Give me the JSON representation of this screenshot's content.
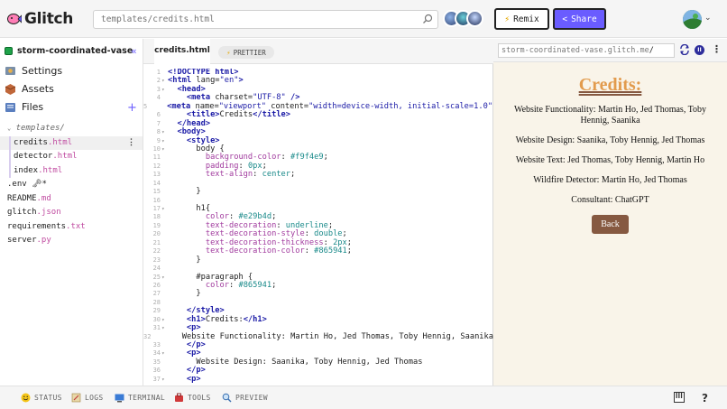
{
  "topbar": {
    "logo_text": "Glitch",
    "search_placeholder": "templates/credits.html",
    "remix_label": "Remix",
    "share_label": "Share"
  },
  "sidebar": {
    "project_name": "storm-coordinated-vase",
    "nav": [
      {
        "label": "Settings"
      },
      {
        "label": "Assets"
      },
      {
        "label": "Files"
      }
    ],
    "tree": [
      {
        "name": "templates/",
        "ext": "",
        "type": "folder"
      },
      {
        "name": "credits",
        "ext": ".html",
        "type": "child",
        "active": true
      },
      {
        "name": "detector",
        "ext": ".html",
        "type": "child"
      },
      {
        "name": "index",
        "ext": ".html",
        "type": "child"
      },
      {
        "name": ".env 🗝*",
        "ext": "",
        "type": "file"
      },
      {
        "name": "README",
        "ext": ".md",
        "type": "file"
      },
      {
        "name": "glitch",
        "ext": ".json",
        "type": "file"
      },
      {
        "name": "requirements",
        "ext": ".txt",
        "type": "file"
      },
      {
        "name": "server",
        "ext": ".py",
        "type": "file"
      }
    ]
  },
  "editor": {
    "tab_label": "credits.html",
    "prettier_label": "PRETTIER",
    "lines": [
      {
        "n": "1",
        "f": "",
        "html": "<span class='t-tag'>&lt;!DOCTYPE html&gt;</span>"
      },
      {
        "n": "2",
        "f": "▾",
        "html": "<span class='t-tag'>&lt;html</span> <span class='t-attr'>lang=</span><span class='t-str'>\"en\"</span><span class='t-tag'>&gt;</span>"
      },
      {
        "n": "3",
        "f": "▾",
        "html": "  <span class='t-tag'>&lt;head&gt;</span>"
      },
      {
        "n": "4",
        "f": "",
        "html": "    <span class='t-tag'>&lt;meta</span> <span class='t-attr'>charset=</span><span class='t-str'>\"UTF-8\"</span> <span class='t-tag'>/&gt;</span>"
      },
      {
        "n": "5",
        "f": "",
        "html": "    <span class='t-tag'>&lt;meta</span> <span class='t-attr'>name=</span><span class='t-str'>\"viewport\"</span> <span class='t-attr'>content=</span><span class='t-str'>\"width=device-width, initial-scale=1.0\"</span> <span class='t-tag'>/&gt;</span>"
      },
      {
        "n": "6",
        "f": "",
        "html": "    <span class='t-tag'>&lt;title&gt;</span>Credits<span class='t-tag'>&lt;/title&gt;</span>"
      },
      {
        "n": "7",
        "f": "",
        "html": "  <span class='t-tag'>&lt;/head&gt;</span>"
      },
      {
        "n": "8",
        "f": "▾",
        "html": "  <span class='t-tag'>&lt;body&gt;</span>"
      },
      {
        "n": "9",
        "f": "▾",
        "html": "    <span class='t-tag'>&lt;style&gt;</span>"
      },
      {
        "n": "10",
        "f": "▾",
        "html": "      <span class='t-sel'>body</span> {"
      },
      {
        "n": "11",
        "f": "",
        "html": "        <span class='t-prop'>background-color</span>: <span class='t-val'>#f9f4e9</span>;"
      },
      {
        "n": "12",
        "f": "",
        "html": "        <span class='t-prop'>padding</span>: <span class='t-val'>0px</span>;"
      },
      {
        "n": "13",
        "f": "",
        "html": "        <span class='t-prop'>text-align</span>: <span class='t-val'>center</span>;"
      },
      {
        "n": "14",
        "f": "",
        "html": ""
      },
      {
        "n": "15",
        "f": "",
        "html": "      }"
      },
      {
        "n": "16",
        "f": "",
        "html": ""
      },
      {
        "n": "17",
        "f": "▾",
        "html": "      <span class='t-sel'>h1</span>{"
      },
      {
        "n": "18",
        "f": "",
        "html": "        <span class='t-prop'>color</span>: <span class='t-val'>#e29b4d</span>;"
      },
      {
        "n": "19",
        "f": "",
        "html": "        <span class='t-prop'>text-decoration</span>: <span class='t-val'>underline</span>;"
      },
      {
        "n": "20",
        "f": "",
        "html": "        <span class='t-prop'>text-decoration-style</span>: <span class='t-val'>double</span>;"
      },
      {
        "n": "21",
        "f": "",
        "html": "        <span class='t-prop'>text-decoration-thickness</span>: <span class='t-val'>2px</span>;"
      },
      {
        "n": "22",
        "f": "",
        "html": "        <span class='t-prop'>text-decoration-color</span>: <span class='t-val'>#865941</span>;"
      },
      {
        "n": "23",
        "f": "",
        "html": "      }"
      },
      {
        "n": "24",
        "f": "",
        "html": ""
      },
      {
        "n": "25",
        "f": "▾",
        "html": "      <span class='t-sel'>#paragraph</span> {"
      },
      {
        "n": "26",
        "f": "",
        "html": "        <span class='t-prop'>color</span>: <span class='t-val'>#865941</span>;"
      },
      {
        "n": "27",
        "f": "",
        "html": "      }"
      },
      {
        "n": "28",
        "f": "",
        "html": ""
      },
      {
        "n": "29",
        "f": "",
        "html": "    <span class='t-tag'>&lt;/style&gt;</span>"
      },
      {
        "n": "30",
        "f": "▾",
        "html": "    <span class='t-tag'>&lt;h1&gt;</span>Credits:<span class='t-tag'>&lt;/h1&gt;</span>"
      },
      {
        "n": "31",
        "f": "▾",
        "html": "    <span class='t-tag'>&lt;p&gt;</span>"
      },
      {
        "n": "32",
        "f": "",
        "html": "      Website Functionality: Martin Ho, Jed Thomas, Toby Hennig, Saanika"
      },
      {
        "n": "33",
        "f": "",
        "html": "    <span class='t-tag'>&lt;/p&gt;</span>"
      },
      {
        "n": "34",
        "f": "▾",
        "html": "    <span class='t-tag'>&lt;p&gt;</span>"
      },
      {
        "n": "35",
        "f": "",
        "html": "      Website Design: Saanika, Toby Hennig, Jed Thomas"
      },
      {
        "n": "36",
        "f": "",
        "html": "    <span class='t-tag'>&lt;/p&gt;</span>"
      },
      {
        "n": "37",
        "f": "▾",
        "html": "    <span class='t-tag'>&lt;p&gt;</span>"
      }
    ]
  },
  "preview": {
    "url_text": "storm-coordinated-vase.glitch.me",
    "url_slash": "/",
    "heading": "Credits:",
    "paragraphs": [
      "Website Functionality: Martin Ho, Jed Thomas, Toby Hennig, Saanika",
      "Website Design: Saanika, Toby Hennig, Jed Thomas",
      "Website Text: Jed Thomas, Toby Hennig, Martin Ho",
      "Wildfire Detector: Martin Ho, Jed Thomas",
      "Consultant: ChatGPT"
    ],
    "back_label": "Back"
  },
  "bottombar": {
    "items": [
      "STATUS",
      "LOGS",
      "TERMINAL",
      "TOOLS",
      "PREVIEW"
    ]
  },
  "colors": {
    "accent": "#6a5cff",
    "preview_bg": "#f9f4e9",
    "heading": "#e29b4d",
    "button": "#865941"
  }
}
